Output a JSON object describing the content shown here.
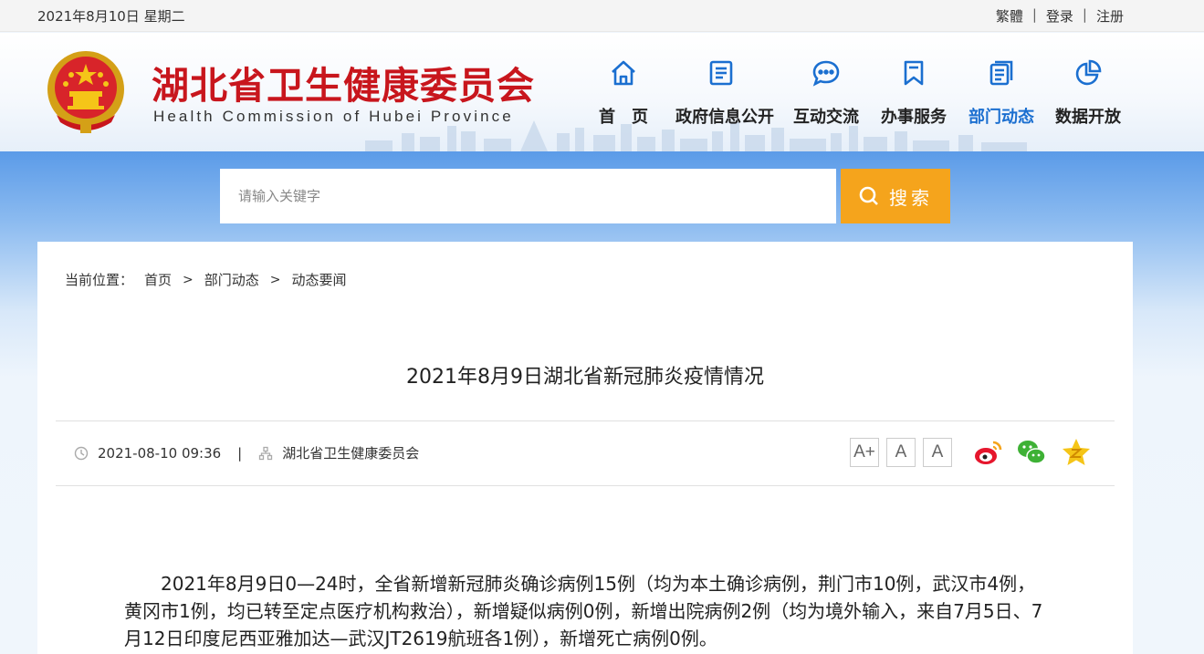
{
  "topbar": {
    "date": "2021年8月10日 星期二",
    "traditional": "繁體",
    "login": "登录",
    "register": "注册",
    "separator": "|"
  },
  "header": {
    "title": "湖北省卫生健康委员会",
    "subtitle": "Health Commission of Hubei Province"
  },
  "nav": [
    {
      "label": "首　页",
      "icon": "home-icon"
    },
    {
      "label": "政府信息公开",
      "icon": "document-icon"
    },
    {
      "label": "互动交流",
      "icon": "chat-icon"
    },
    {
      "label": "办事服务",
      "icon": "bookmark-icon"
    },
    {
      "label": "部门动态",
      "icon": "news-icon",
      "active": true
    },
    {
      "label": "数据开放",
      "icon": "pie-chart-icon"
    }
  ],
  "search": {
    "placeholder": "请输入关键字",
    "button_label": "搜索"
  },
  "breadcrumb": {
    "prefix": "当前位置：",
    "items": [
      "首页",
      "部门动态",
      "动态要闻"
    ],
    "separator": ">"
  },
  "article": {
    "title": "2021年8月9日湖北省新冠肺炎疫情情况",
    "datetime": "2021-08-10 09:36",
    "meta_separator": "|",
    "source": "湖北省卫生健康委员会",
    "body": "2021年8月9日0—24时，全省新增新冠肺炎确诊病例15例（均为本土确诊病例，荆门市10例，武汉市4例，黄冈市1例，均已转至定点医疗机构救治），新增疑似病例0例，新增出院病例2例（均为境外输入，来自7月5日、7月12日印度尼西亚雅加达—武汉JT2619航班各1例），新增死亡病例0例。"
  },
  "font_buttons": [
    "A+",
    "A",
    "A"
  ],
  "colors": {
    "brand_red": "#c8161d",
    "nav_blue": "#1b6fd0",
    "search_orange": "#f5a41c"
  }
}
